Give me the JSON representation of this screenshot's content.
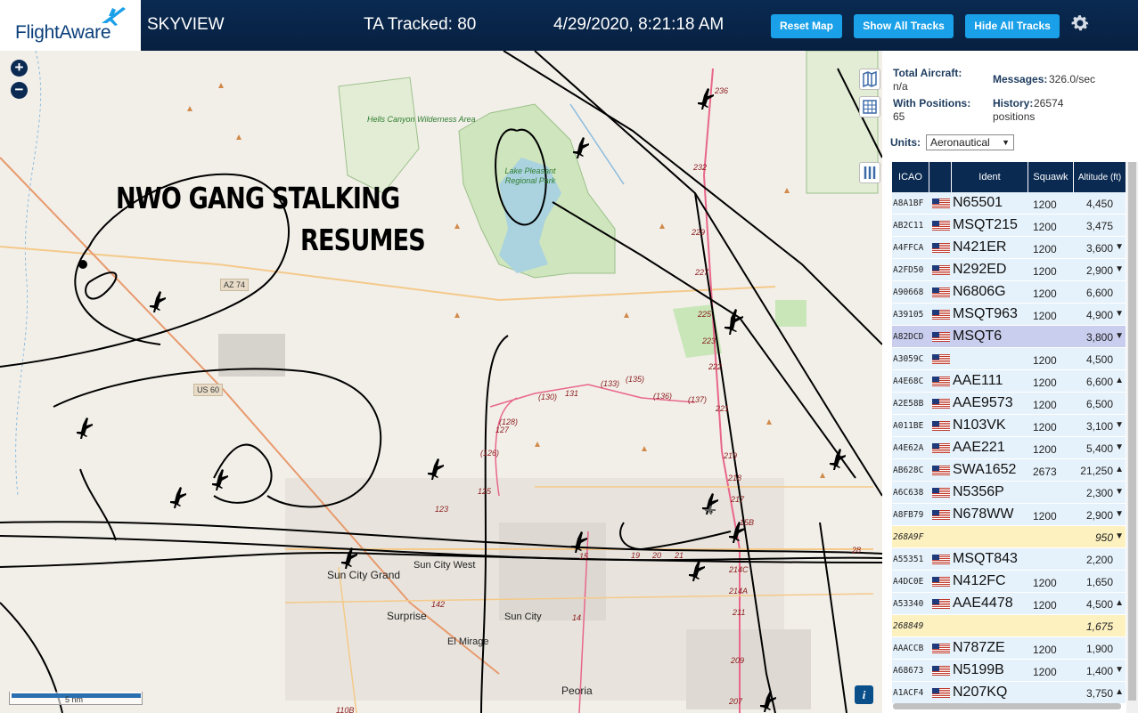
{
  "header": {
    "logo": "FlightAware",
    "app_title": "SKYVIEW",
    "tracked": "TA Tracked: 80",
    "clock": "4/29/2020, 8:21:18 AM",
    "buttons": {
      "reset": "Reset Map",
      "show_all": "Show All Tracks",
      "hide_all": "Hide All Tracks"
    },
    "settings_icon": "gear-icon",
    "colors": {
      "bar": "#0a2a52",
      "button": "#1aa0e8"
    }
  },
  "map": {
    "overlay_text": [
      "NWO GANG STALKING",
      "RESUMES"
    ],
    "zoom_in": "+",
    "zoom_out": "−",
    "info": "i",
    "scale": "5 nm",
    "places": {
      "sun_city_grand": "Sun City Grand",
      "sun_city_west": "Sun City West",
      "surprise": "Surprise",
      "sun_city": "Sun City",
      "el_mirage": "El Mirage",
      "peoria": "Peoria",
      "lake_pleasant": "Lake Pleasant Regional Park",
      "hells_canyon": "Hells Canyon Wilderness Area"
    },
    "highways": {
      "az74": "AZ 74",
      "us60": "US 60"
    },
    "route_labels": [
      "236",
      "232",
      "229",
      "227",
      "225",
      "223",
      "222",
      "221",
      "219",
      "218",
      "217",
      "15B",
      "15",
      "(130)",
      "131",
      "(133)",
      "(135)",
      "(136)",
      "(137)",
      "(128)",
      "127",
      "(126)",
      "125",
      "123",
      "142",
      "14",
      "211",
      "209",
      "207",
      "110B",
      "21",
      "20",
      "19",
      "28",
      "214A",
      "214C"
    ],
    "tools": [
      "map-layers-icon",
      "grid-icon",
      "columns-icon"
    ],
    "colors": {
      "land": "#f2efe9",
      "water": "#aad3df",
      "park": "#c8e6b8",
      "track": "#000000",
      "route": "#e8668a"
    }
  },
  "panel": {
    "total_aircraft_label": "Total Aircraft:",
    "total_aircraft_value": "n/a",
    "messages_label": "Messages:",
    "messages_value": "326.0/sec",
    "with_positions_label": "With Positions:",
    "with_positions_value": "65",
    "history_label": "History:",
    "history_value": "26574 positions",
    "units_label": "Units:",
    "units_value": "Aeronautical",
    "columns": {
      "icao": "ICAO",
      "ident": "Ident",
      "squawk": "Squawk",
      "altitude": "Altitude (ft)"
    },
    "rows": [
      {
        "icao": "A8A1BF",
        "ident": "N65501",
        "squawk": "1200",
        "alt": "4,450",
        "trend": "",
        "state": "normal"
      },
      {
        "icao": "AB2C11",
        "ident": "MSQT215",
        "squawk": "1200",
        "alt": "3,475",
        "trend": "",
        "state": "normal"
      },
      {
        "icao": "A4FFCA",
        "ident": "N421ER",
        "squawk": "1200",
        "alt": "3,600",
        "trend": "▼",
        "state": "normal"
      },
      {
        "icao": "A2FD50",
        "ident": "N292ED",
        "squawk": "1200",
        "alt": "2,900",
        "trend": "▼",
        "state": "normal"
      },
      {
        "icao": "A90668",
        "ident": "N6806G",
        "squawk": "1200",
        "alt": "6,600",
        "trend": "",
        "state": "normal"
      },
      {
        "icao": "A39105",
        "ident": "MSQT963",
        "squawk": "1200",
        "alt": "4,900",
        "trend": "▼",
        "state": "normal"
      },
      {
        "icao": "A82DCD",
        "ident": "MSQT6",
        "squawk": "",
        "alt": "3,800",
        "trend": "▼",
        "state": "selected"
      },
      {
        "icao": "A3059C",
        "ident": "",
        "squawk": "1200",
        "alt": "4,500",
        "trend": "",
        "state": "normal"
      },
      {
        "icao": "A4E68C",
        "ident": "AAE111",
        "squawk": "1200",
        "alt": "6,600",
        "trend": "▲",
        "state": "normal"
      },
      {
        "icao": "A2E58B",
        "ident": "AAE9573",
        "squawk": "1200",
        "alt": "6,500",
        "trend": "",
        "state": "normal"
      },
      {
        "icao": "A011BE",
        "ident": "N103VK",
        "squawk": "1200",
        "alt": "3,100",
        "trend": "▼",
        "state": "normal"
      },
      {
        "icao": "A4E62A",
        "ident": "AAE221",
        "squawk": "1200",
        "alt": "5,400",
        "trend": "▼",
        "state": "normal"
      },
      {
        "icao": "AB628C",
        "ident": "SWA1652",
        "squawk": "2673",
        "alt": "21,250",
        "trend": "▲",
        "state": "normal"
      },
      {
        "icao": "A6C638",
        "ident": "N5356P",
        "squawk": "",
        "alt": "2,300",
        "trend": "▼",
        "state": "normal"
      },
      {
        "icao": "A8FB79",
        "ident": "N678WW",
        "squawk": "1200",
        "alt": "2,900",
        "trend": "▼",
        "state": "normal"
      },
      {
        "icao": "268A9F",
        "ident": "",
        "squawk": "",
        "alt": "950",
        "trend": "▼",
        "state": "nopos"
      },
      {
        "icao": "A55351",
        "ident": "MSQT843",
        "squawk": "",
        "alt": "2,200",
        "trend": "",
        "state": "normal"
      },
      {
        "icao": "A4DC0E",
        "ident": "N412FC",
        "squawk": "1200",
        "alt": "1,650",
        "trend": "",
        "state": "normal"
      },
      {
        "icao": "A53340",
        "ident": "AAE4478",
        "squawk": "1200",
        "alt": "4,500",
        "trend": "▲",
        "state": "normal"
      },
      {
        "icao": "268849",
        "ident": "",
        "squawk": "",
        "alt": "1,675",
        "trend": "",
        "state": "nopos"
      },
      {
        "icao": "AAACCB",
        "ident": "N787ZE",
        "squawk": "1200",
        "alt": "1,900",
        "trend": "",
        "state": "normal"
      },
      {
        "icao": "A68673",
        "ident": "N5199B",
        "squawk": "1200",
        "alt": "1,400",
        "trend": "▼",
        "state": "normal"
      },
      {
        "icao": "A1ACF4",
        "ident": "N207KQ",
        "squawk": "",
        "alt": "3,750",
        "trend": "▲",
        "state": "normal"
      }
    ]
  }
}
